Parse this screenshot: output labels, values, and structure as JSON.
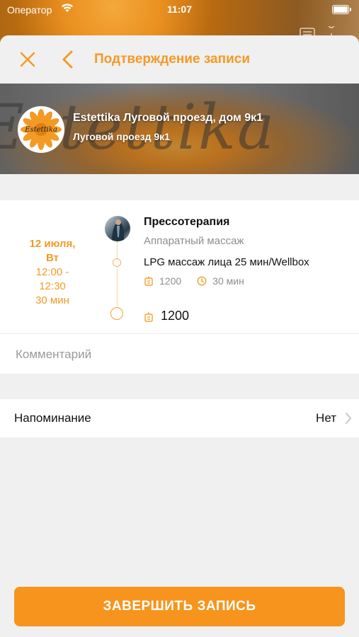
{
  "status_bar": {
    "carrier": "Оператор",
    "time": "11:07"
  },
  "navbar": {
    "title": "Подтверждение записи",
    "close_icon": "close-icon",
    "back_icon": "chevron-left-icon"
  },
  "salon": {
    "name": "Estettika Луговой проезд, дом 9к1",
    "address": "Луговой проезд 9к1",
    "logo_text": "Estettika"
  },
  "booking": {
    "date_line1": "12 июля,",
    "date_line2": "Вт",
    "time_start": "12:00 -",
    "time_end": "12:30",
    "duration": "30 мин",
    "master_name": "Прессотерапия",
    "category": "Аппаратный массаж",
    "service_name": "LPG массаж лица 25 мин/Wellbox",
    "service_price": "1200",
    "service_duration": "30 мин",
    "total_price": "1200"
  },
  "comment": {
    "placeholder": "Комментарий",
    "value": ""
  },
  "reminder": {
    "label": "Напоминание",
    "value": "Нет"
  },
  "finish_button": {
    "label": "ЗАВЕРШИТЬ ЗАПИСЬ"
  },
  "colors": {
    "accent": "#f39a24",
    "button": "#f7941d",
    "background": "#f0f0f0"
  }
}
